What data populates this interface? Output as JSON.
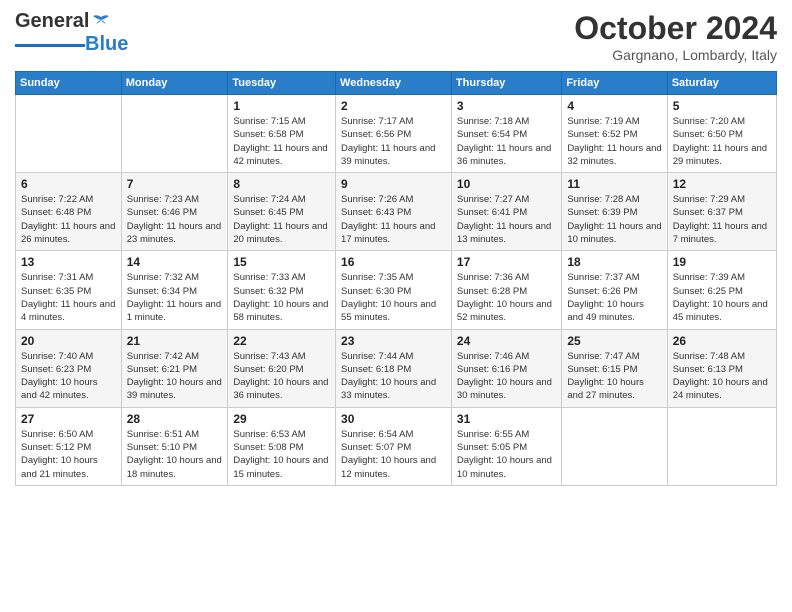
{
  "logo": {
    "line1": "General",
    "line2": "Blue"
  },
  "header": {
    "month": "October 2024",
    "location": "Gargnano, Lombardy, Italy"
  },
  "weekdays": [
    "Sunday",
    "Monday",
    "Tuesday",
    "Wednesday",
    "Thursday",
    "Friday",
    "Saturday"
  ],
  "weeks": [
    [
      {
        "day": "",
        "info": ""
      },
      {
        "day": "",
        "info": ""
      },
      {
        "day": "1",
        "info": "Sunrise: 7:15 AM\nSunset: 6:58 PM\nDaylight: 11 hours and 42 minutes."
      },
      {
        "day": "2",
        "info": "Sunrise: 7:17 AM\nSunset: 6:56 PM\nDaylight: 11 hours and 39 minutes."
      },
      {
        "day": "3",
        "info": "Sunrise: 7:18 AM\nSunset: 6:54 PM\nDaylight: 11 hours and 36 minutes."
      },
      {
        "day": "4",
        "info": "Sunrise: 7:19 AM\nSunset: 6:52 PM\nDaylight: 11 hours and 32 minutes."
      },
      {
        "day": "5",
        "info": "Sunrise: 7:20 AM\nSunset: 6:50 PM\nDaylight: 11 hours and 29 minutes."
      }
    ],
    [
      {
        "day": "6",
        "info": "Sunrise: 7:22 AM\nSunset: 6:48 PM\nDaylight: 11 hours and 26 minutes."
      },
      {
        "day": "7",
        "info": "Sunrise: 7:23 AM\nSunset: 6:46 PM\nDaylight: 11 hours and 23 minutes."
      },
      {
        "day": "8",
        "info": "Sunrise: 7:24 AM\nSunset: 6:45 PM\nDaylight: 11 hours and 20 minutes."
      },
      {
        "day": "9",
        "info": "Sunrise: 7:26 AM\nSunset: 6:43 PM\nDaylight: 11 hours and 17 minutes."
      },
      {
        "day": "10",
        "info": "Sunrise: 7:27 AM\nSunset: 6:41 PM\nDaylight: 11 hours and 13 minutes."
      },
      {
        "day": "11",
        "info": "Sunrise: 7:28 AM\nSunset: 6:39 PM\nDaylight: 11 hours and 10 minutes."
      },
      {
        "day": "12",
        "info": "Sunrise: 7:29 AM\nSunset: 6:37 PM\nDaylight: 11 hours and 7 minutes."
      }
    ],
    [
      {
        "day": "13",
        "info": "Sunrise: 7:31 AM\nSunset: 6:35 PM\nDaylight: 11 hours and 4 minutes."
      },
      {
        "day": "14",
        "info": "Sunrise: 7:32 AM\nSunset: 6:34 PM\nDaylight: 11 hours and 1 minute."
      },
      {
        "day": "15",
        "info": "Sunrise: 7:33 AM\nSunset: 6:32 PM\nDaylight: 10 hours and 58 minutes."
      },
      {
        "day": "16",
        "info": "Sunrise: 7:35 AM\nSunset: 6:30 PM\nDaylight: 10 hours and 55 minutes."
      },
      {
        "day": "17",
        "info": "Sunrise: 7:36 AM\nSunset: 6:28 PM\nDaylight: 10 hours and 52 minutes."
      },
      {
        "day": "18",
        "info": "Sunrise: 7:37 AM\nSunset: 6:26 PM\nDaylight: 10 hours and 49 minutes."
      },
      {
        "day": "19",
        "info": "Sunrise: 7:39 AM\nSunset: 6:25 PM\nDaylight: 10 hours and 45 minutes."
      }
    ],
    [
      {
        "day": "20",
        "info": "Sunrise: 7:40 AM\nSunset: 6:23 PM\nDaylight: 10 hours and 42 minutes."
      },
      {
        "day": "21",
        "info": "Sunrise: 7:42 AM\nSunset: 6:21 PM\nDaylight: 10 hours and 39 minutes."
      },
      {
        "day": "22",
        "info": "Sunrise: 7:43 AM\nSunset: 6:20 PM\nDaylight: 10 hours and 36 minutes."
      },
      {
        "day": "23",
        "info": "Sunrise: 7:44 AM\nSunset: 6:18 PM\nDaylight: 10 hours and 33 minutes."
      },
      {
        "day": "24",
        "info": "Sunrise: 7:46 AM\nSunset: 6:16 PM\nDaylight: 10 hours and 30 minutes."
      },
      {
        "day": "25",
        "info": "Sunrise: 7:47 AM\nSunset: 6:15 PM\nDaylight: 10 hours and 27 minutes."
      },
      {
        "day": "26",
        "info": "Sunrise: 7:48 AM\nSunset: 6:13 PM\nDaylight: 10 hours and 24 minutes."
      }
    ],
    [
      {
        "day": "27",
        "info": "Sunrise: 6:50 AM\nSunset: 5:12 PM\nDaylight: 10 hours and 21 minutes."
      },
      {
        "day": "28",
        "info": "Sunrise: 6:51 AM\nSunset: 5:10 PM\nDaylight: 10 hours and 18 minutes."
      },
      {
        "day": "29",
        "info": "Sunrise: 6:53 AM\nSunset: 5:08 PM\nDaylight: 10 hours and 15 minutes."
      },
      {
        "day": "30",
        "info": "Sunrise: 6:54 AM\nSunset: 5:07 PM\nDaylight: 10 hours and 12 minutes."
      },
      {
        "day": "31",
        "info": "Sunrise: 6:55 AM\nSunset: 5:05 PM\nDaylight: 10 hours and 10 minutes."
      },
      {
        "day": "",
        "info": ""
      },
      {
        "day": "",
        "info": ""
      }
    ]
  ]
}
